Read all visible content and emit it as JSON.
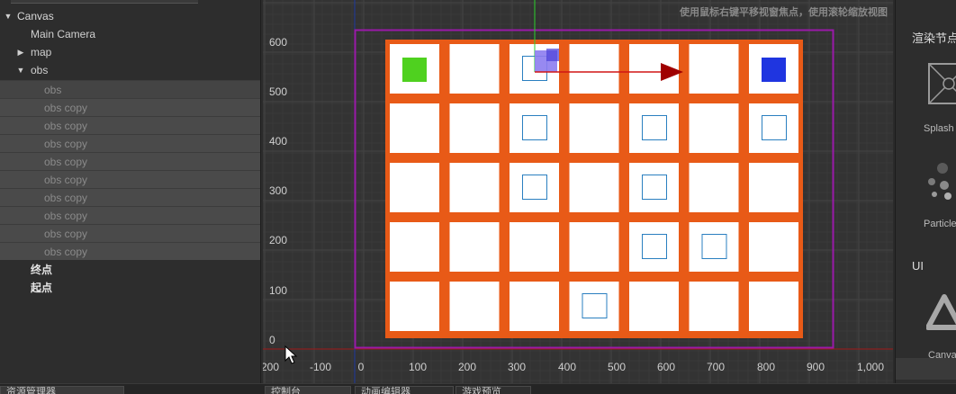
{
  "hierarchy": {
    "nodes": [
      {
        "label": "Canvas",
        "expanded": true
      },
      {
        "label": "Main Camera"
      },
      {
        "label": "map",
        "expanded": false
      },
      {
        "label": "obs",
        "expanded": true
      },
      {
        "label": "obs"
      },
      {
        "label": "obs copy"
      },
      {
        "label": "obs copy"
      },
      {
        "label": "obs copy"
      },
      {
        "label": "obs copy"
      },
      {
        "label": "obs copy"
      },
      {
        "label": "obs copy"
      },
      {
        "label": "obs copy"
      },
      {
        "label": "obs copy"
      },
      {
        "label": "obs copy"
      },
      {
        "label": "终点"
      },
      {
        "label": "起点"
      }
    ]
  },
  "scene": {
    "hint": "使用鼠标右键平移视窗焦点，使用滚轮缩放视图",
    "y_ticks": [
      "600",
      "500",
      "400",
      "300",
      "200",
      "100",
      "0"
    ],
    "x_ticks": [
      "200",
      "-100",
      "0",
      "100",
      "200",
      "300",
      "400",
      "500",
      "600",
      "700",
      "800",
      "900",
      "1,000"
    ],
    "grid": {
      "rows": 5,
      "cols": 7
    },
    "grid_color": "#e85a17",
    "start_color": "#4fd11f",
    "end_color": "#1f35e0",
    "outline_color": "#2a7fc0",
    "canvas_border_color": "#9a1aa8",
    "obstacles": [
      [
        0,
        2
      ],
      [
        1,
        2
      ],
      [
        1,
        4
      ],
      [
        1,
        6
      ],
      [
        2,
        2
      ],
      [
        2,
        4
      ],
      [
        3,
        4
      ],
      [
        3,
        5
      ],
      [
        4,
        3
      ]
    ]
  },
  "right_panel": {
    "section_title": "渲染节点",
    "items": [
      "Splash",
      "Particle"
    ],
    "ui_title": "UI",
    "ui_items": [
      "Canvas"
    ]
  },
  "bottom_tabs": [
    "资源管理器",
    "控制台",
    "动画编辑器",
    "游戏预览"
  ]
}
